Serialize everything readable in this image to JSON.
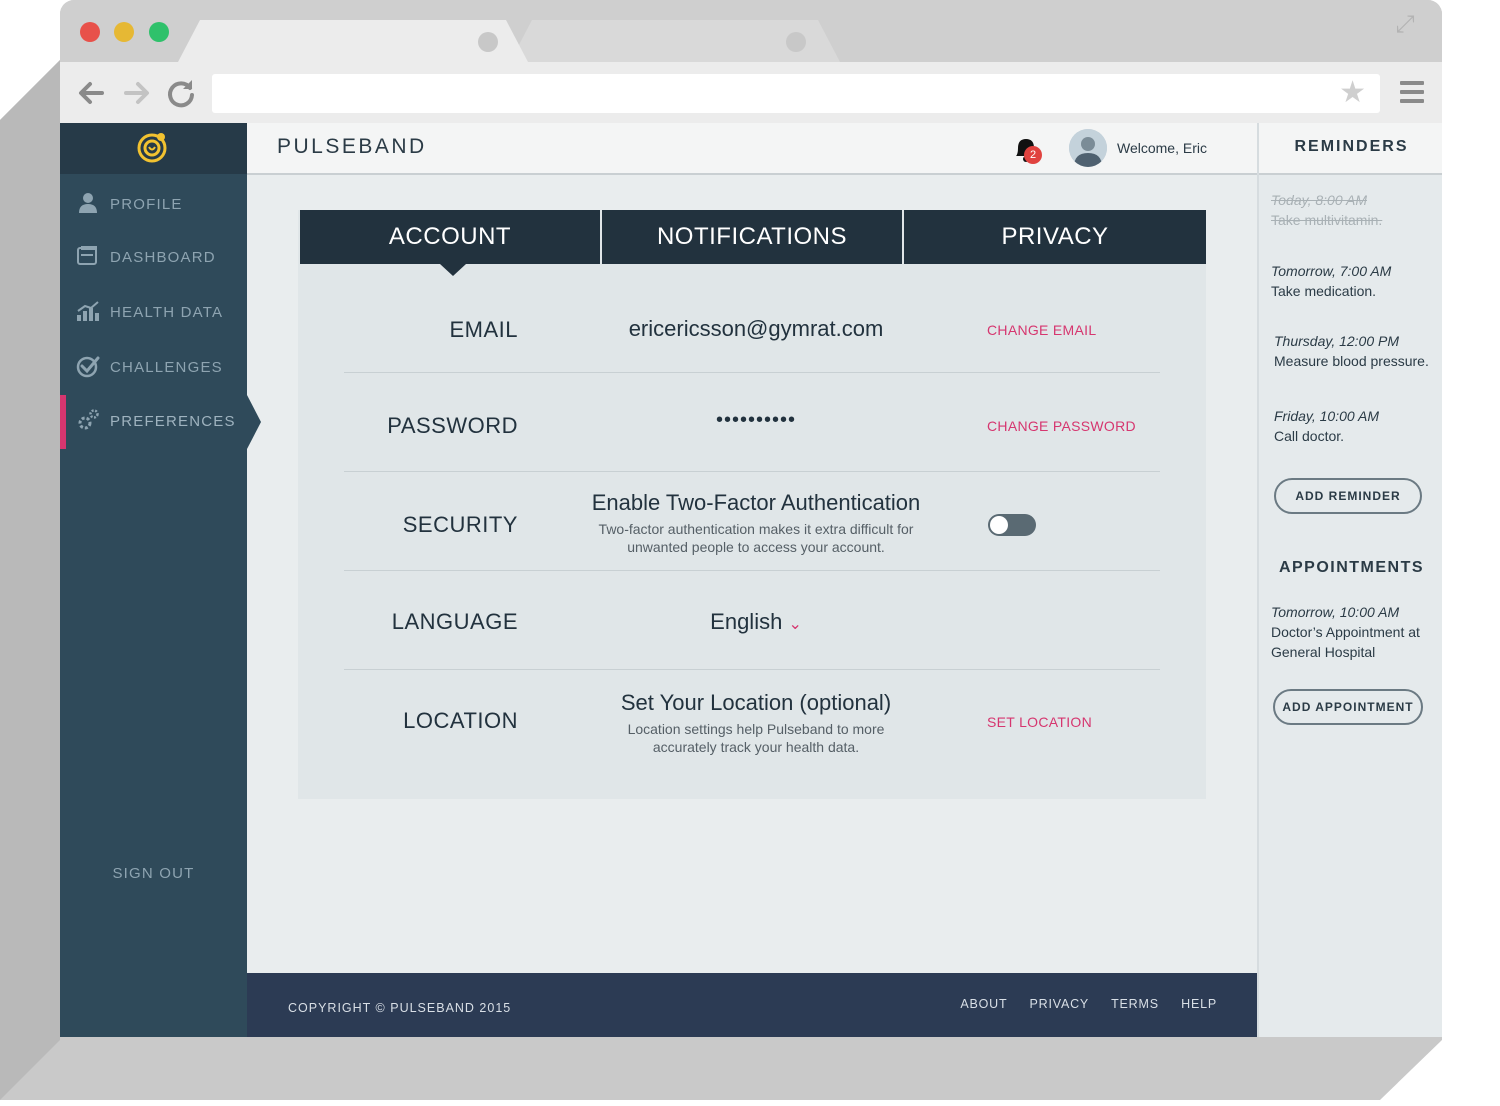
{
  "app": {
    "brand": "PULSEBAND",
    "welcome": "Welcome, Eric",
    "notification_count": "2"
  },
  "sidebar": {
    "items": [
      {
        "label": "PROFILE",
        "icon": "user-icon"
      },
      {
        "label": "DASHBOARD",
        "icon": "dashboard-icon"
      },
      {
        "label": "HEALTH DATA",
        "icon": "bar-chart-icon"
      },
      {
        "label": "CHALLENGES",
        "icon": "check-circle-icon"
      },
      {
        "label": "PREFERENCES",
        "icon": "gears-icon",
        "active": true
      }
    ],
    "signout": "SIGN OUT"
  },
  "settings": {
    "tabs": [
      "ACCOUNT",
      "NOTIFICATIONS",
      "PRIVACY"
    ],
    "active_tab": "ACCOUNT",
    "email": {
      "label": "EMAIL",
      "value": "ericericsson@gymrat.com",
      "action": "CHANGE EMAIL"
    },
    "password": {
      "label": "PASSWORD",
      "value": "••••••••••",
      "action": "CHANGE PASSWORD"
    },
    "security": {
      "label": "SECURITY",
      "title": "Enable Two-Factor Authentication",
      "desc_line1": "Two-factor authentication makes it extra difficult for",
      "desc_line2": "unwanted people to access your account.",
      "enabled": false
    },
    "language": {
      "label": "LANGUAGE",
      "value": "English"
    },
    "location": {
      "label": "LOCATION",
      "title": "Set Your Location (optional)",
      "desc_line1": "Location settings help Pulseband to more",
      "desc_line2": "accurately track your health data.",
      "action": "SET LOCATION"
    }
  },
  "reminders": {
    "title": "REMINDERS",
    "items": [
      {
        "time": "Today, 8:00 AM",
        "text": "Take multivitamin.",
        "done": true
      },
      {
        "time": "Tomorrow, 7:00 AM",
        "text": "Take medication.",
        "done": false
      },
      {
        "time": "Thursday, 12:00 PM",
        "text": "Measure blood pressure.",
        "done": false
      },
      {
        "time": "Friday, 10:00 AM",
        "text": "Call doctor.",
        "done": false
      }
    ],
    "add_button": "ADD REMINDER"
  },
  "appointments": {
    "title": "APPOINTMENTS",
    "items": [
      {
        "time": "Tomorrow, 10:00 AM",
        "text_line1": "Doctor’s Appointment at",
        "text_line2": "General Hospital"
      }
    ],
    "add_button": "ADD APPOINTMENT"
  },
  "footer": {
    "copyright": "COPYRIGHT © PULSEBAND 2015",
    "links": [
      "ABOUT",
      "PRIVACY",
      "TERMS",
      "HELP"
    ]
  },
  "colors": {
    "accent": "#d6366f",
    "sidebar": "#2f4a5a",
    "tabs": "#22323e",
    "footer": "#2c3b54"
  }
}
